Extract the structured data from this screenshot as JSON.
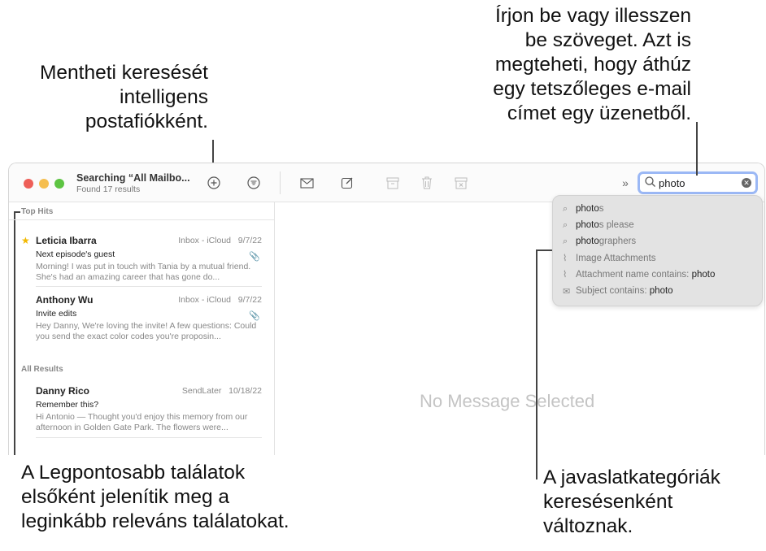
{
  "callouts": {
    "top_left": [
      "Mentheti keresését",
      "intelligens",
      "postafiókként."
    ],
    "top_right": [
      "Írjon be vagy illesszen",
      "be szöveget. Azt is",
      "megteheti, hogy áthúz",
      "egy tetszőleges e-mail",
      "címet egy üzenetből."
    ],
    "bottom_left": [
      "A Legpontosabb találatok",
      "elsőként jelenítik meg a",
      "leginkább releváns találatokat."
    ],
    "bottom_right": [
      "A javaslatkategóriák",
      "keresésenként",
      "változnak."
    ]
  },
  "window": {
    "title": "Searching “All Mailbo...",
    "subtitle": "Found 17 results",
    "search_value": "photo",
    "colors": {
      "close": "#ee5f58",
      "minimize": "#f5be4f",
      "zoom": "#5dc442",
      "search_focus": "#9bb8f5"
    }
  },
  "sidebar": {
    "top_hits_label": "Top Hits",
    "all_results_label": "All Results",
    "messages": [
      {
        "from": "Leticia Ibarra",
        "mailbox": "Inbox - iCloud",
        "date": "9/7/22",
        "subject": "Next episode's guest",
        "preview": "Morning! I was put in touch with Tania by a mutual friend. She's had an amazing career that has gone do...",
        "flagged": true,
        "attachment": true
      },
      {
        "from": "Anthony Wu",
        "mailbox": "Inbox - iCloud",
        "date": "9/7/22",
        "subject": "Invite edits",
        "preview": "Hey Danny, We're loving the invite! A few questions: Could you send the exact color codes you're proposin...",
        "flagged": false,
        "attachment": true
      },
      {
        "from": "Danny Rico",
        "mailbox": "SendLater",
        "date": "10/18/22",
        "subject": "Remember this?",
        "preview": "Hi Antonio — Thought you'd enjoy this memory from our afternoon in Golden Gate Park. The flowers were...",
        "flagged": false,
        "attachment": false
      }
    ]
  },
  "content": {
    "empty_label": "No Message Selected"
  },
  "suggestions": [
    {
      "icon": "search-icon",
      "match": "photo",
      "rest": "s"
    },
    {
      "icon": "search-icon",
      "match": "photo",
      "rest": "s please"
    },
    {
      "icon": "search-icon",
      "match": "photo",
      "rest": "graphers"
    },
    {
      "icon": "paperclip-icon",
      "match": "",
      "rest": "Image Attachments"
    },
    {
      "icon": "paperclip-icon",
      "prefix": "Attachment name contains: ",
      "term": "photo"
    },
    {
      "icon": "envelope-icon",
      "prefix": "Subject contains: ",
      "term": "photo"
    }
  ]
}
